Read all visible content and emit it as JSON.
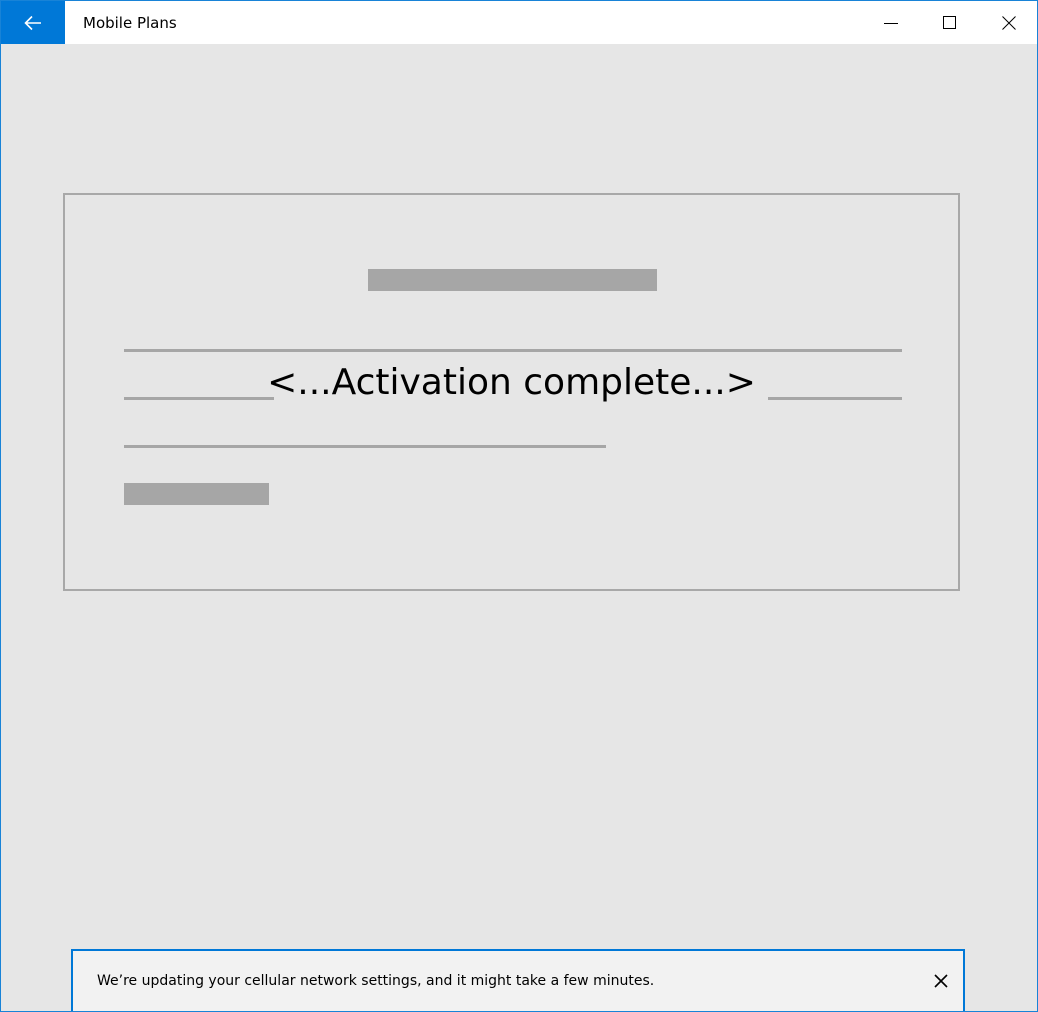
{
  "window": {
    "title": "Mobile Plans",
    "accent_color": "#0078d7",
    "background_color": "#e6e6e6",
    "icons": {
      "back": "back-arrow-icon",
      "minimize": "minimize-icon",
      "maximize": "maximize-icon",
      "close": "close-icon"
    }
  },
  "content": {
    "activation_message": "<...Activation complete...>"
  },
  "notification": {
    "message": "We’re updating your cellular network settings, and it might take a few minutes.",
    "close_icon": "close-icon"
  }
}
